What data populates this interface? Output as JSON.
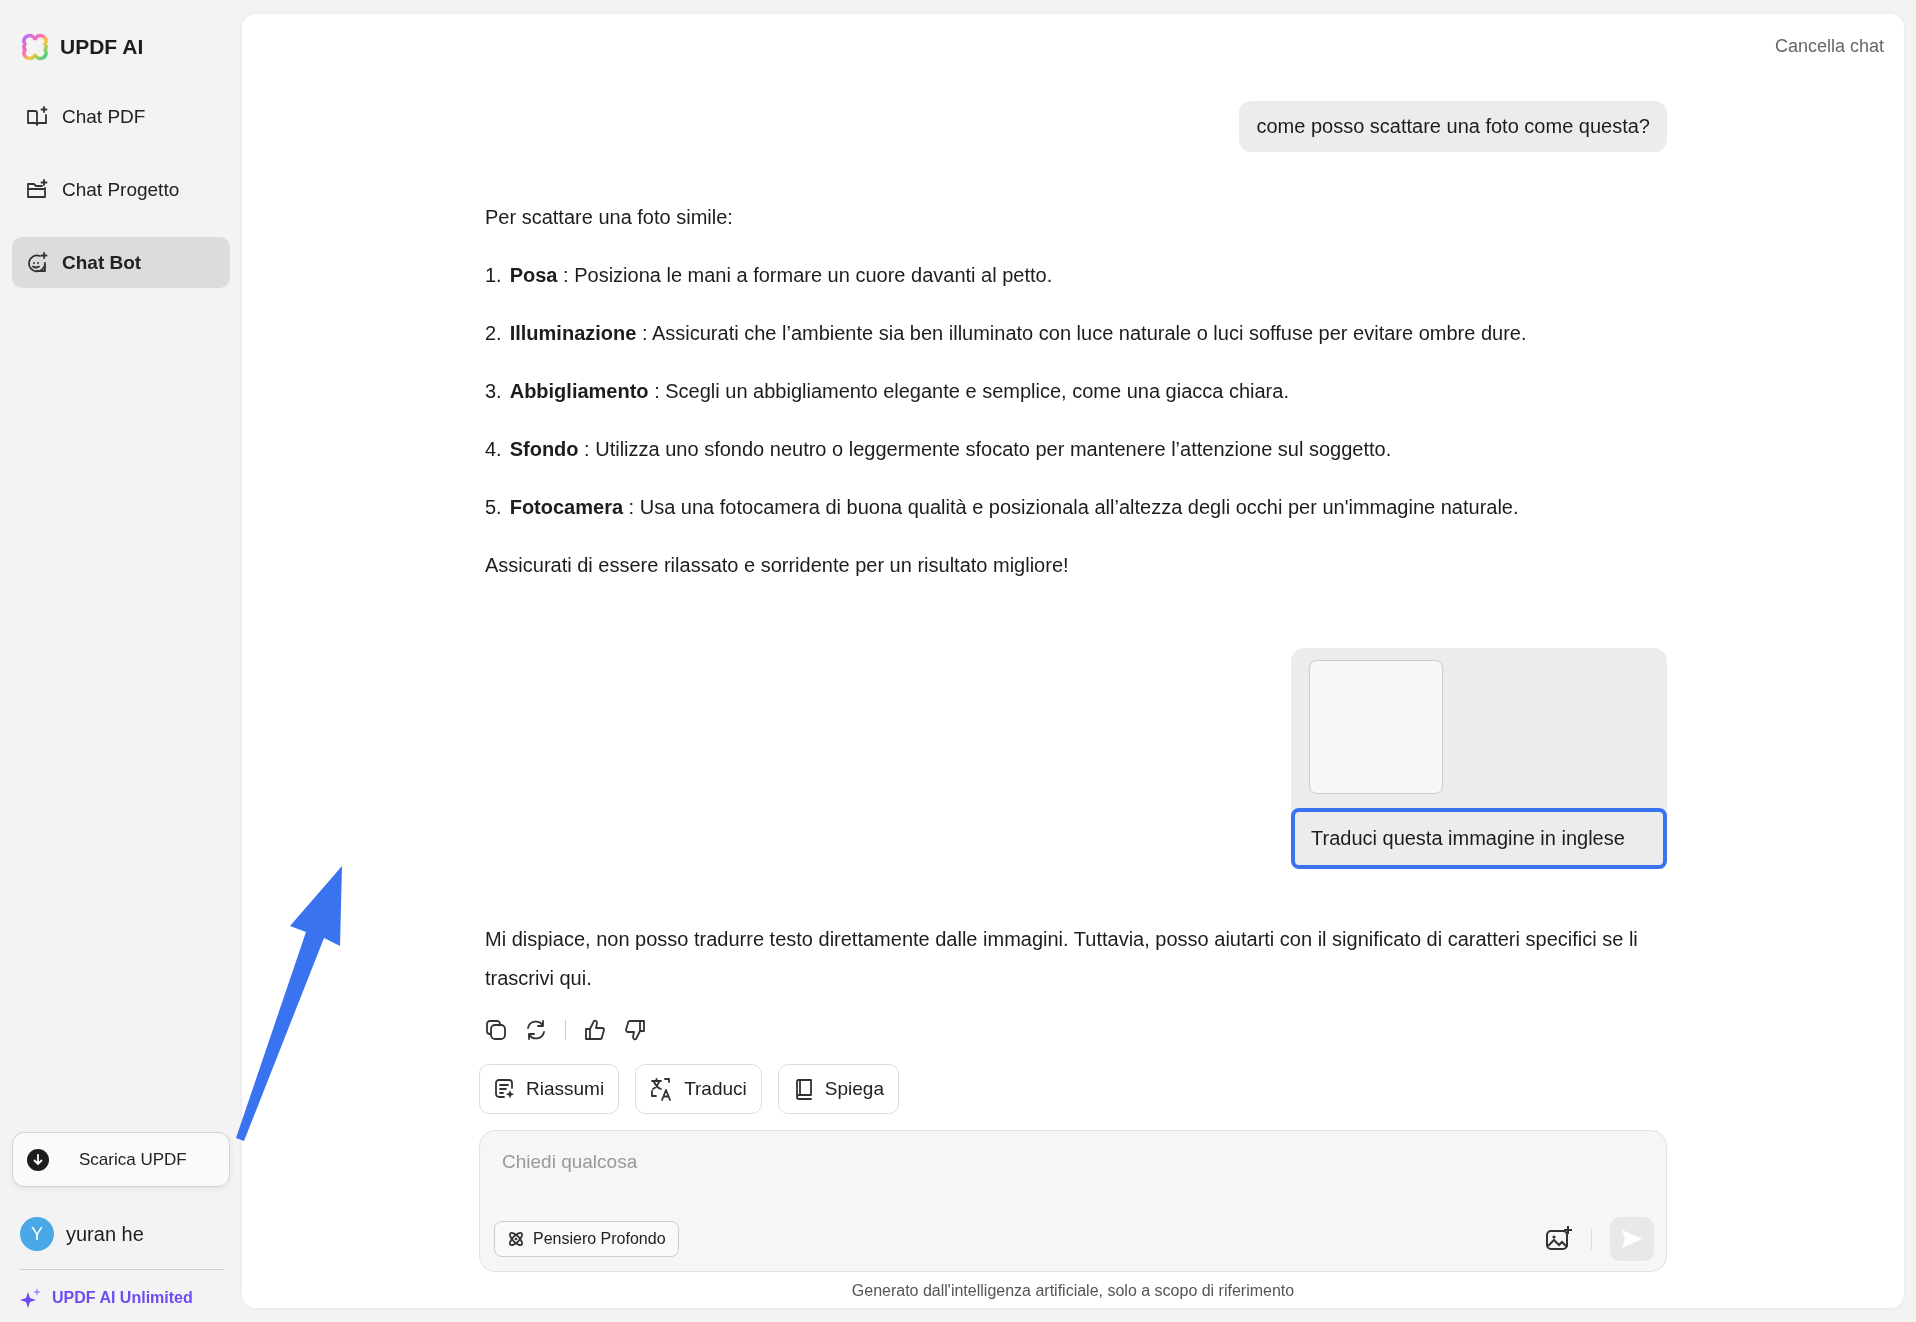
{
  "app": {
    "name": "UPDF AI"
  },
  "sidebar": {
    "items": [
      {
        "label": "Chat PDF",
        "selected": false
      },
      {
        "label": "Chat Progetto",
        "selected": false
      },
      {
        "label": "Chat Bot",
        "selected": true
      }
    ],
    "download_button": "Scarica UPDF",
    "user": {
      "initial": "Y",
      "name": "yuran he"
    },
    "plan": "UPDF AI Unlimited"
  },
  "header": {
    "clear_chat": "Cancella chat"
  },
  "messages": [
    {
      "kind": "user",
      "text": "come posso scattare una foto come questa?"
    },
    {
      "kind": "bot",
      "intro": "Per scattare una foto simile:",
      "items": [
        {
          "number": "1.",
          "text": "**Posa** : Posiziona le mani a formare un cuore davanti al petto."
        },
        {
          "number": "2.",
          "text": "**Illuminazione** : Assicurati che l’ambiente sia ben illuminato con luce naturale o luci soffuse per evitare ombre dure."
        },
        {
          "number": "3.",
          "text": "**Abbigliamento** : Scegli un abbigliamento elegante e semplice, come una giacca chiara."
        },
        {
          "number": "4.",
          "text": "**Sfondo** : Utilizza uno sfondo neutro o leggermente sfocato per mantenere l’attenzione sul soggetto."
        },
        {
          "number": "5.",
          "text": "**Fotocamera** : Usa una fotocamera di buona qualità e posizionala all’altezza degli occhi per un'immagine naturale."
        }
      ],
      "outro": "Assicurati di essere rilassato e sorridente per un risultato migliore!"
    },
    {
      "kind": "user_image",
      "text": "Traduci questa immagine in inglese",
      "highlighted": true
    },
    {
      "kind": "bot_reply",
      "text": "Mi dispiace, non posso tradurre testo direttamente dalle immagini. Tuttavia, posso aiutarti con il significato di caratteri specifici se li trascrivi qui."
    }
  ],
  "quick_actions": [
    {
      "label": "Riassumi"
    },
    {
      "label": "Traduci"
    },
    {
      "label": "Spiega"
    }
  ],
  "input": {
    "placeholder": "Chiedi qualcosa",
    "deep_think": "Pensiero Profondo"
  },
  "footer_note": "Generato dall'intelligenza artificiale, solo a scopo di riferimento"
}
